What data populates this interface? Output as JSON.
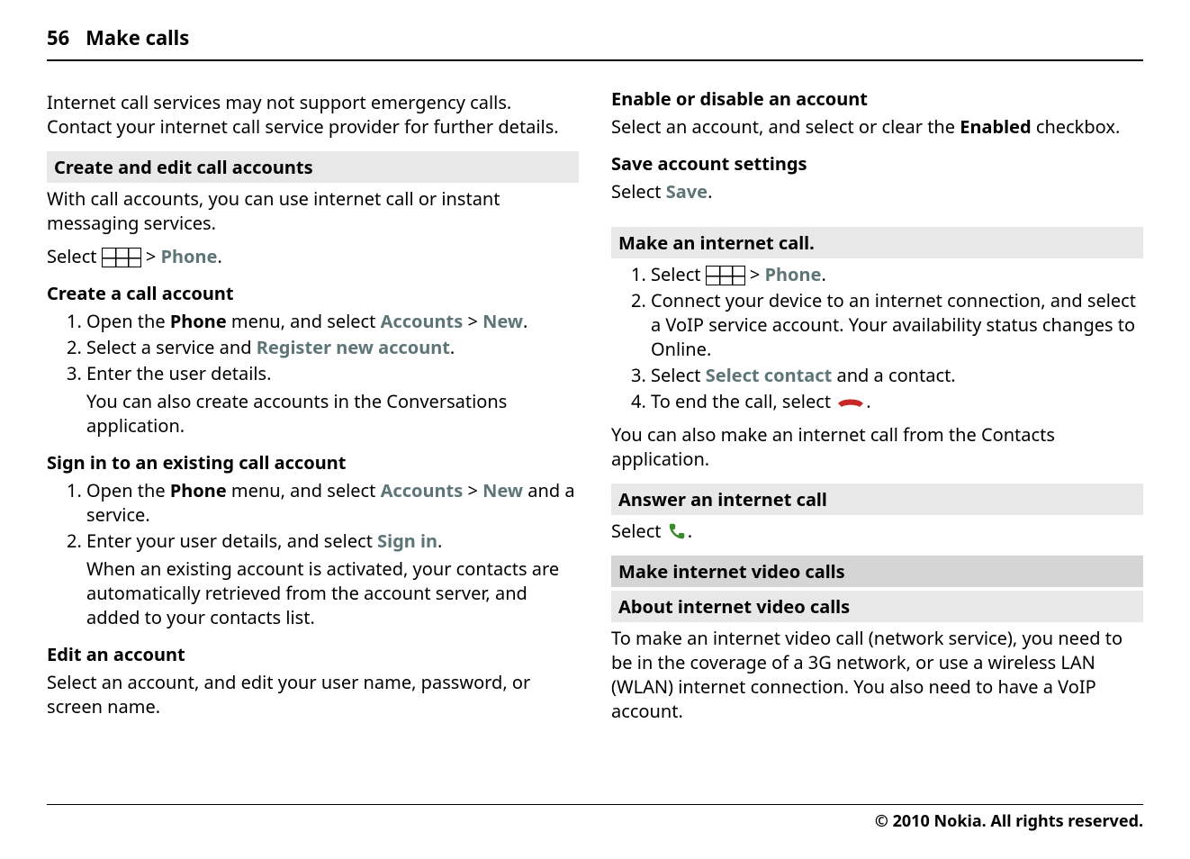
{
  "page_number": "56",
  "section_title": "Make calls",
  "left": {
    "intro": "Internet call services may not support emergency calls. Contact your internet call service provider for further details.",
    "h_create_edit": "Create and edit call accounts",
    "p_create_edit": "With call accounts, you can use internet call or instant messaging services.",
    "select_prefix": "Select ",
    "select_sep": "  > ",
    "select_phone": "Phone",
    "select_suffix": ".",
    "h_create_account": "Create a call account",
    "create_steps": {
      "s1_a": "Open the ",
      "s1_phone": "Phone",
      "s1_b": " menu, and select ",
      "s1_accounts": "Accounts",
      "s1_sep": "  > ",
      "s1_new": "New",
      "s1_end": ".",
      "s2_a": "Select a service and ",
      "s2_reg": "Register new account",
      "s2_end": ".",
      "s3_a": "Enter the user details.",
      "s3_note": "You can also create accounts in the Conversations application."
    },
    "h_signin": "Sign in to an existing call account",
    "signin_steps": {
      "s1_a": "Open the ",
      "s1_phone": "Phone",
      "s1_b": " menu, and select ",
      "s1_accounts": "Accounts",
      "s1_sep": "  > ",
      "s1_new": "New",
      "s1_end": " and a service.",
      "s2_a": "Enter your user details, and select ",
      "s2_signin": "Sign in",
      "s2_end": ".",
      "s2_note": "When an existing account is activated, your contacts are automatically retrieved from the account server, and added to your contacts list."
    },
    "h_edit": "Edit an account",
    "p_edit": "Select an account, and edit your user name, password, or screen name."
  },
  "right": {
    "h_enable": "Enable or disable an account",
    "p_enable_a": "Select an account, and select or clear the ",
    "p_enable_b": "Enabled",
    "p_enable_c": " checkbox.",
    "h_save": "Save account settings",
    "p_save_a": "Select ",
    "p_save_b": "Save",
    "p_save_c": ".",
    "h_makecall": "Make an internet call.",
    "make_steps": {
      "s1_a": "Select ",
      "s1_sep": "  > ",
      "s1_phone": "Phone",
      "s1_end": ".",
      "s2": "Connect your device to an internet connection, and select a VoIP service account. Your availability status changes to Online.",
      "s3_a": "Select ",
      "s3_b": "Select contact",
      "s3_c": " and a contact.",
      "s4_a": "To end the call, select ",
      "s4_end": "."
    },
    "p_make_note": "You can also make an internet call from the Contacts application.",
    "h_answer": "Answer an internet call",
    "p_answer_a": "Select ",
    "p_answer_end": ".",
    "h_video_main": "Make internet video calls",
    "h_video_sub": "About internet video calls",
    "p_video": "To make an internet video call (network service), you need to be in the coverage of a 3G network, or use a wireless LAN (WLAN) internet connection. You also need to have a VoIP account."
  },
  "footer": "© 2010 Nokia. All rights reserved."
}
